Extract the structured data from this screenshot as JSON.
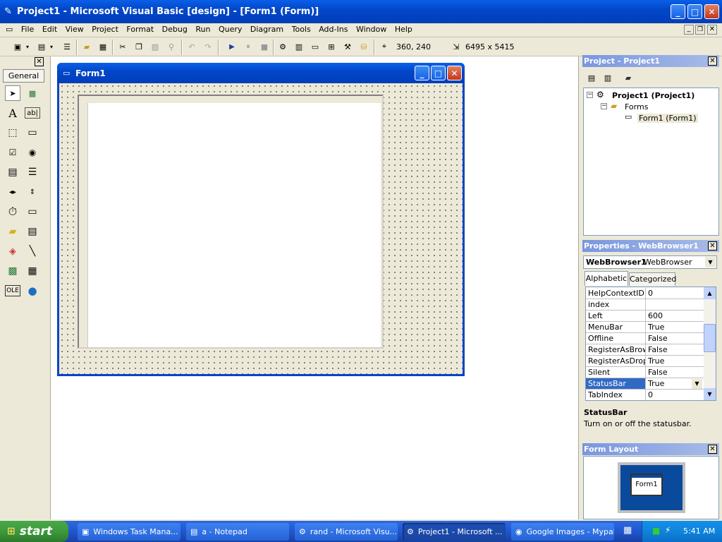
{
  "app": {
    "title": "Project1 - Microsoft Visual Basic [design] - [Form1 (Form)]"
  },
  "menu": [
    "File",
    "Edit",
    "View",
    "Project",
    "Format",
    "Debug",
    "Run",
    "Query",
    "Diagram",
    "Tools",
    "Add-Ins",
    "Window",
    "Help"
  ],
  "toolbar": {
    "position": "360, 240",
    "size": "6495 x 5415"
  },
  "toolbox": {
    "tab_label": "General"
  },
  "form_window": {
    "title": "Form1"
  },
  "project_panel": {
    "title": "Project - Project1",
    "root": "Project1 (Project1)",
    "folder": "Forms",
    "item": "Form1 (Form1)"
  },
  "properties_panel": {
    "title": "Properties - WebBrowser1",
    "object_name": "WebBrowser1",
    "object_type": "WebBrowser",
    "tab_alphabetic": "Alphabetic",
    "tab_categorized": "Categorized",
    "rows": [
      {
        "name": "HelpContextID",
        "value": "0"
      },
      {
        "name": "index",
        "value": ""
      },
      {
        "name": "Left",
        "value": "600"
      },
      {
        "name": "MenuBar",
        "value": "True"
      },
      {
        "name": "Offline",
        "value": "False"
      },
      {
        "name": "RegisterAsBrowse",
        "value": "False"
      },
      {
        "name": "RegisterAsDropTa",
        "value": "True"
      },
      {
        "name": "Silent",
        "value": "False"
      },
      {
        "name": "StatusBar",
        "value": "True"
      },
      {
        "name": "TabIndex",
        "value": "0"
      }
    ],
    "selected_row": 8,
    "desc_title": "StatusBar",
    "desc_text": "Turn on or off the statusbar."
  },
  "layout_panel": {
    "title": "Form Layout",
    "form_label": "Form1"
  },
  "taskbar": {
    "start_label": "start",
    "items": [
      "Windows Task Mana...",
      "a - Notepad",
      "rand - Microsoft Visu...",
      "Project1 - Microsoft ...",
      "Google Images - Mypal"
    ],
    "clock": "5:41 AM"
  },
  "colors": {
    "title_blue": "#0247c9",
    "selection": "#316ac5",
    "taskbar": "#245edb",
    "start_green": "#3c9a3c"
  }
}
